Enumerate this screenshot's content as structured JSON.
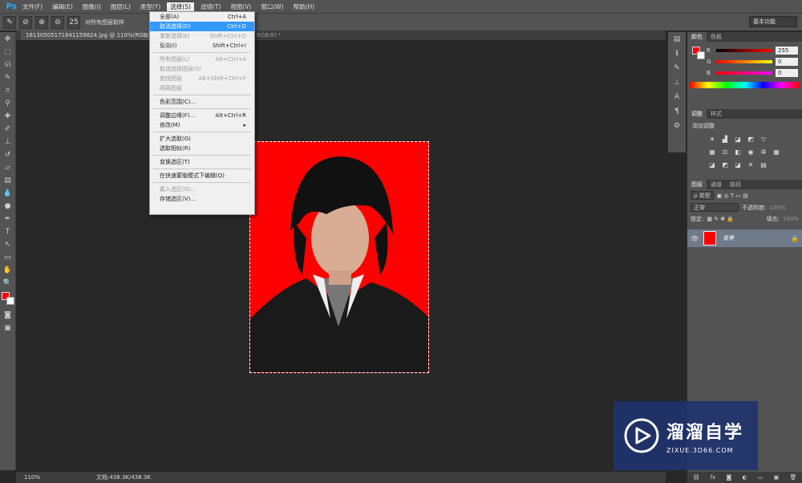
{
  "menubar": {
    "logo": "Ps",
    "items": [
      {
        "label": "文件(F)"
      },
      {
        "label": "编辑(E)"
      },
      {
        "label": "图像(I)"
      },
      {
        "label": "图层(L)"
      },
      {
        "label": "类型(Y)"
      },
      {
        "label": "选择(S)"
      },
      {
        "label": "滤镜(T)"
      },
      {
        "label": "视图(V)"
      },
      {
        "label": "窗口(W)"
      },
      {
        "label": "帮助(H)"
      }
    ]
  },
  "options": {
    "brush_size": "25",
    "sample_all_layers": "对所有图层取样",
    "workspace": "基本功能"
  },
  "document": {
    "tab_title": "18130505171841159824.jpg @ 110%(RGB/8#)",
    "tab2_title": "RGB/8) *",
    "zoom": "110%",
    "doc_size": "文档:438.3K/438.3K"
  },
  "select_menu": {
    "items": [
      {
        "label": "全部(A)",
        "shortcut": "Ctrl+A",
        "state": "normal"
      },
      {
        "label": "取消选择(D)",
        "shortcut": "Ctrl+D",
        "state": "highlight"
      },
      {
        "label": "重新选择(E)",
        "shortcut": "Shift+Ctrl+D",
        "state": "disabled"
      },
      {
        "label": "反向(I)",
        "shortcut": "Shift+Ctrl+I",
        "state": "normal"
      },
      {
        "sep": true
      },
      {
        "label": "所有图层(L)",
        "shortcut": "Alt+Ctrl+A",
        "state": "disabled"
      },
      {
        "label": "取消选择图层(S)",
        "shortcut": "",
        "state": "disabled"
      },
      {
        "label": "查找图层",
        "shortcut": "Alt+Shift+Ctrl+F",
        "state": "disabled"
      },
      {
        "label": "隔离图层",
        "shortcut": "",
        "state": "disabled"
      },
      {
        "sep": true
      },
      {
        "label": "色彩范围(C)...",
        "shortcut": "",
        "state": "normal"
      },
      {
        "sep": true
      },
      {
        "label": "调整边缘(F)...",
        "shortcut": "Alt+Ctrl+R",
        "state": "normal"
      },
      {
        "label": "修改(M)",
        "shortcut": "▸",
        "state": "normal"
      },
      {
        "sep": true
      },
      {
        "label": "扩大选取(G)",
        "shortcut": "",
        "state": "normal"
      },
      {
        "label": "选取相似(R)",
        "shortcut": "",
        "state": "normal"
      },
      {
        "sep": true
      },
      {
        "label": "变换选区(T)",
        "shortcut": "",
        "state": "normal"
      },
      {
        "sep": true
      },
      {
        "label": "在快速蒙版模式下编辑(Q)",
        "shortcut": "",
        "state": "normal"
      },
      {
        "sep": true
      },
      {
        "label": "载入选区(O)...",
        "shortcut": "",
        "state": "disabled"
      },
      {
        "label": "存储选区(V)...",
        "shortcut": "",
        "state": "normal"
      }
    ]
  },
  "color_panel": {
    "tabs": [
      "颜色",
      "色板"
    ],
    "r_label": "R",
    "r_value": "255",
    "g_label": "G",
    "g_value": "0",
    "b_label": "B",
    "b_value": "0",
    "accent": "#ff0000"
  },
  "adjust_panel": {
    "tabs": [
      "调整",
      "样式"
    ],
    "title": "添加调整"
  },
  "layers_panel": {
    "tabs": [
      "图层",
      "通道",
      "路径"
    ],
    "filter": "ρ 类型",
    "blend_mode": "正常",
    "opacity_label": "不透明度:",
    "opacity_value": "100%",
    "lock_label": "锁定:",
    "fill_label": "填充:",
    "fill_value": "100%",
    "layer_name": "背景"
  },
  "watermark": {
    "title": "溜溜自学",
    "url": "ZIXUE.3D66.COM"
  }
}
